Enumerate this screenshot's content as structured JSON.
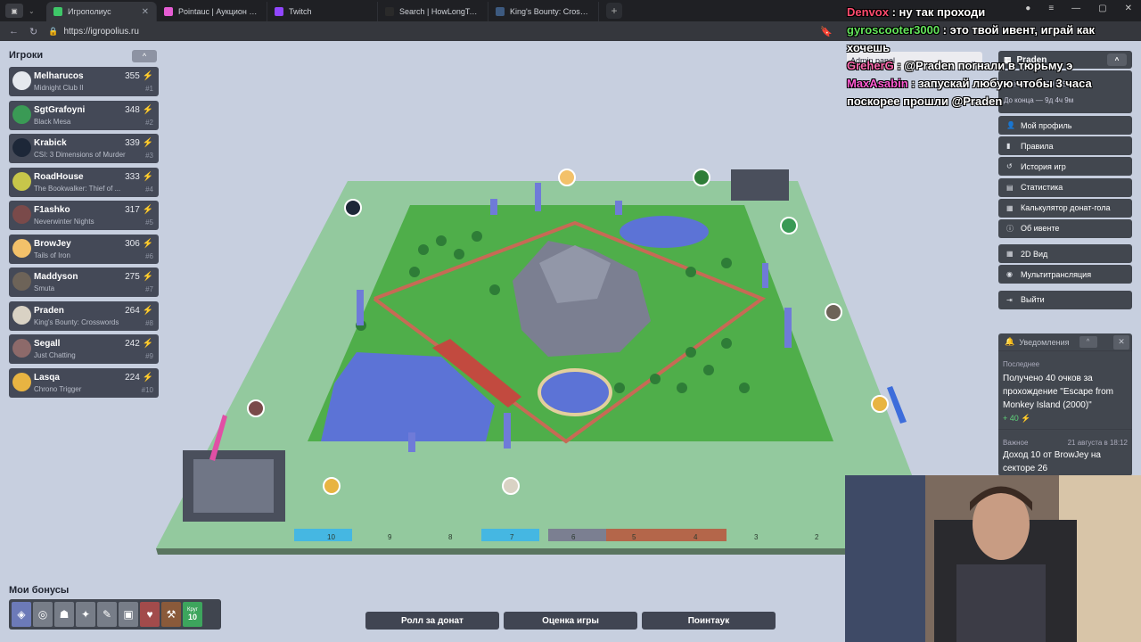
{
  "browser": {
    "tabs": [
      {
        "title": "Игрополиус",
        "active": true,
        "color": "#3ec768"
      },
      {
        "title": "Pointauc | Аукцион для ст",
        "active": false,
        "color": "#e55cd3"
      },
      {
        "title": "Twitch",
        "active": false,
        "color": "#9146ff"
      },
      {
        "title": "Search | HowLongToBeat",
        "active": false,
        "color": "#2a2a2a"
      },
      {
        "title": "King's Bounty: Crossworld",
        "active": false,
        "color": "#3d5a80"
      }
    ],
    "url": "https://igropolius.ru",
    "new_tab": "+"
  },
  "players_panel": {
    "title": "Игроки",
    "collapse": "^",
    "players": [
      {
        "name": "Melharucos",
        "game": "Midnight Club II",
        "score": "355",
        "rank": "#1",
        "color": "#e5e8ee"
      },
      {
        "name": "SgtGrafoyni",
        "game": "Black Mesa",
        "score": "348",
        "rank": "#2",
        "color": "#3a9a55"
      },
      {
        "name": "Krabick",
        "game": "CSI: 3 Dimensions of Murder",
        "score": "339",
        "rank": "#3",
        "color": "#1d2738"
      },
      {
        "name": "RoadHouse",
        "game": "The Bookwalker: Thief of ...",
        "score": "333",
        "rank": "#4",
        "color": "#c7c64a"
      },
      {
        "name": "F1ashko",
        "game": "Neverwinter Nights",
        "score": "317",
        "rank": "#5",
        "color": "#7a4a4a"
      },
      {
        "name": "BrowJey",
        "game": "Tails of Iron",
        "score": "306",
        "rank": "#6",
        "color": "#f3c16a"
      },
      {
        "name": "Maddyson",
        "game": "Smuta",
        "score": "275",
        "rank": "#7",
        "color": "#6d6358"
      },
      {
        "name": "Praden",
        "game": "King's Bounty: Crosswords",
        "score": "264",
        "rank": "#8",
        "color": "#d9d2c4"
      },
      {
        "name": "Segall",
        "game": "Just Chatting",
        "score": "242",
        "rank": "#9",
        "color": "#8d6a6a"
      },
      {
        "name": "Lasqa",
        "game": "Chrono Trigger",
        "score": "224",
        "rank": "#10",
        "color": "#e8b442"
      }
    ]
  },
  "bonuses": {
    "title": "Мои бонусы",
    "lap_label": "Круг",
    "lap_value": "10"
  },
  "actions": {
    "roll": "Ролл за донат",
    "rate": "Оценка игры",
    "pointauc": "Поинтаук"
  },
  "menu": {
    "user": "Praden",
    "timer_line1": "Время — 18:39 MSK",
    "timer_line2": "До конца — 9д 4ч 9м",
    "items": [
      {
        "label": "Мой профиль",
        "icon": "👤"
      },
      {
        "label": "Правила",
        "icon": "▮"
      },
      {
        "label": "История игр",
        "icon": "↺"
      },
      {
        "label": "Статистика",
        "icon": "▤"
      },
      {
        "label": "Калькулятор донат-гола",
        "icon": "▦"
      },
      {
        "label": "Об ивенте",
        "icon": "ⓘ"
      }
    ],
    "items2": [
      {
        "label": "2D Вид",
        "icon": "▦"
      },
      {
        "label": "Мультитрансляция",
        "icon": "◉"
      }
    ],
    "logout": "Выйти"
  },
  "notifications": {
    "title": "Уведомления",
    "latest_label": "Последнее",
    "latest_text": "Получено 40 очков за прохождение \"Escape from Monkey Island (2000)\"",
    "latest_points": "+ 40",
    "important_label": "Важное",
    "important_date": "21 августа в 18:12",
    "important_text": "Доход 10 от BrowJey на секторе 26"
  },
  "admin_panel": "Admin panel",
  "chat": [
    {
      "user": "Denvox",
      "text": "ну так проходи",
      "color": "#ff4b6e"
    },
    {
      "user": "gyroscooter3000",
      "text": "это твой ивент, играй как хочешь",
      "color": "#63e35a"
    },
    {
      "user": "GreherG",
      "text": "@Praden погнали в тюрьму э",
      "color": "#ff6ab0"
    },
    {
      "user": "MaxAsabin",
      "text": "запускай любую чтобы 3 часа поскорее прошли @Praden",
      "color": "#ff5ad2"
    }
  ],
  "board": {
    "bottom_numbers": [
      "10",
      "9",
      "8",
      "7",
      "6",
      "5",
      "4",
      "3",
      "2"
    ]
  }
}
